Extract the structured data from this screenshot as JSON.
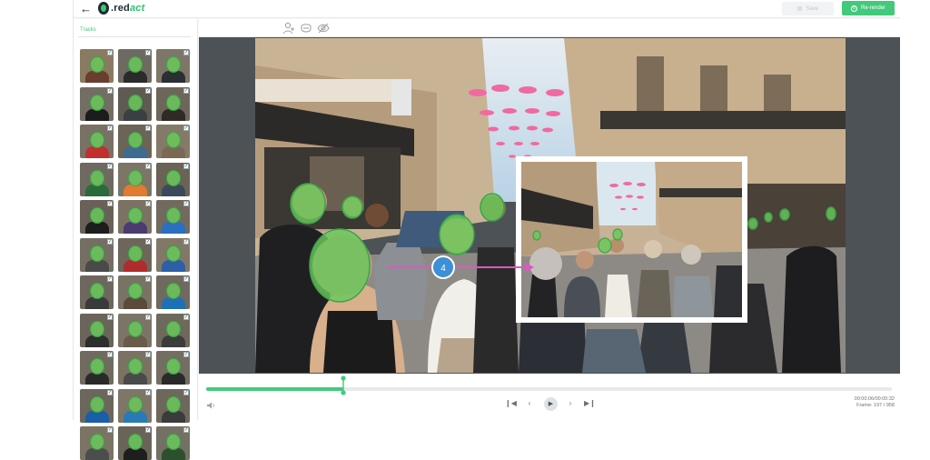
{
  "header": {
    "back_icon": "arrow-left-icon",
    "logo_text": ".redact",
    "save_label": "Save",
    "rerender_label": "Re-render"
  },
  "tracks_panel": {
    "title": "Tracks",
    "thumbnails": [
      {
        "shirt": "#6b3d2e",
        "bg": "#8b7a62",
        "checked": true
      },
      {
        "shirt": "#2b2b2b",
        "bg": "#6f6a61",
        "checked": true
      },
      {
        "shirt": "#2a2f33",
        "bg": "#7e7769",
        "checked": true
      },
      {
        "shirt": "#1c1c1c",
        "bg": "#746d63",
        "checked": true
      },
      {
        "shirt": "#3a3f44",
        "bg": "#5f5a52",
        "checked": true
      },
      {
        "shirt": "#2f2a26",
        "bg": "#6e665a",
        "checked": true
      },
      {
        "shirt": "#c22f2f",
        "bg": "#7a7165",
        "checked": true
      },
      {
        "shirt": "#3e6b8f",
        "bg": "#6b6457",
        "checked": true
      },
      {
        "shirt": "#7a6a55",
        "bg": "#857a69",
        "checked": true
      },
      {
        "shirt": "#2b6a3a",
        "bg": "#6f6a61",
        "checked": true
      },
      {
        "shirt": "#e07b2f",
        "bg": "#7d7567",
        "checked": true
      },
      {
        "shirt": "#3b4a5a",
        "bg": "#6a6356",
        "checked": true
      },
      {
        "shirt": "#1d1d1d",
        "bg": "#696157",
        "checked": true
      },
      {
        "shirt": "#4b3b70",
        "bg": "#7b7263",
        "checked": true
      },
      {
        "shirt": "#2c6ec0",
        "bg": "#726a5e",
        "checked": true
      },
      {
        "shirt": "#4a4a4a",
        "bg": "#756e63",
        "checked": true
      },
      {
        "shirt": "#b02c2c",
        "bg": "#6e665b",
        "checked": true
      },
      {
        "shirt": "#2c5fa8",
        "bg": "#817868",
        "checked": true
      },
      {
        "shirt": "#3a3a3a",
        "bg": "#6d675d",
        "checked": true
      },
      {
        "shirt": "#5a4a3a",
        "bg": "#7a7264",
        "checked": true
      },
      {
        "shirt": "#1f6fb8",
        "bg": "#70695d",
        "checked": true
      },
      {
        "shirt": "#2e2e2e",
        "bg": "#6b645a",
        "checked": true
      },
      {
        "shirt": "#6a5a4a",
        "bg": "#7c7466",
        "checked": true
      },
      {
        "shirt": "#3c3c3c",
        "bg": "#6f685d",
        "checked": true
      },
      {
        "shirt": "#2a2a2a",
        "bg": "#716a5f",
        "checked": true
      },
      {
        "shirt": "#4a4a4a",
        "bg": "#7a7263",
        "checked": true
      },
      {
        "shirt": "#2a2a2a",
        "bg": "#746d61",
        "checked": true
      },
      {
        "shirt": "#1a5ea8",
        "bg": "#6c665c",
        "checked": true
      },
      {
        "shirt": "#2a7ab8",
        "bg": "#7e7667",
        "checked": true
      },
      {
        "shirt": "#3b3b3b",
        "bg": "#6e675c",
        "checked": true
      },
      {
        "shirt": "#4d4d4d",
        "bg": "#7b7364",
        "checked": true
      },
      {
        "shirt": "#1e1e1e",
        "bg": "#6a6358",
        "checked": true
      },
      {
        "shirt": "#2d4f2d",
        "bg": "#757064",
        "checked": true
      }
    ]
  },
  "toolbar": {
    "tools": [
      "add-person-icon",
      "face-mask-icon",
      "hide-icon"
    ]
  },
  "video": {
    "inset_track_number": "4",
    "scene": "street-crowd"
  },
  "player": {
    "progress": 0.2,
    "volume_icon": "volume-icon",
    "buttons": [
      "skip-start-icon",
      "prev-frame-icon",
      "play-icon",
      "next-frame-icon",
      "skip-end-icon"
    ],
    "time": "00:00:06/00:00:32",
    "frame": "Frame: 197 / 958"
  },
  "colors": {
    "accent": "#43c97c",
    "face_overlay": "#6ac85a",
    "arrow": "#e056c5",
    "badge": "#3d8fd6"
  }
}
